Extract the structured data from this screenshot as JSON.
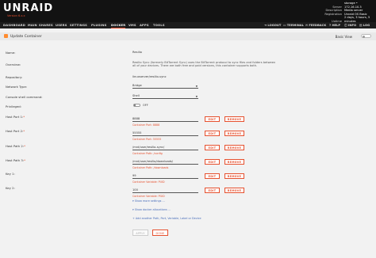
{
  "brand": {
    "logo": "UNRAID",
    "logo_sub": "Version 6.x.x"
  },
  "server_info": [
    {
      "key": "Server",
      "value": "storage • 172.16.10.3"
    },
    {
      "key": "Description",
      "value": "Media server"
    },
    {
      "key": "Registration",
      "value": "Unraid OS Basic"
    },
    {
      "key": "Uptime",
      "value": "2 days, 3 hours, 5 minutes"
    }
  ],
  "nav": {
    "items": [
      "DASHBOARD",
      "MAIN",
      "SHARES",
      "USERS",
      "SETTINGS",
      "PLUGINS",
      "DOCKER",
      "VMS",
      "APPS",
      "TOOLS"
    ],
    "active": "DOCKER",
    "right": [
      "LOGOUT",
      "TERMINAL",
      "FEEDBACK",
      "HELP",
      "INFO",
      "LOG"
    ]
  },
  "page": {
    "title": "Update Container",
    "basic_view_label": "Basic View"
  },
  "form": {
    "name": {
      "label": "Name:",
      "value": "Resilio"
    },
    "overview": {
      "label": "Overview:",
      "value": "Resilio Sync (formerly BitTorrent Sync) uses the BitTorrent protocol to sync files and folders between all of your devices. There are both free and paid versions, this container supports both."
    },
    "repository": {
      "label": "Repository:",
      "value": "linuxserver/resilio-sync"
    },
    "network_type": {
      "label": "Network Type:",
      "value": "Bridge"
    },
    "console_shell": {
      "label": "Console shell command:",
      "value": "Shell"
    },
    "privileged": {
      "label": "Privileged:",
      "value": "OFF"
    },
    "host_port_1": {
      "label": "Host Port 1:",
      "value": "8888",
      "hint": "Container Port: 8888"
    },
    "host_port_2": {
      "label": "Host Port 2:",
      "value": "55555",
      "hint": "Container Port: 55555"
    },
    "host_path_2": {
      "label": "Host Path 2:",
      "value": "/mnt/user/resilio-sync/",
      "hint": "Container Path: /config"
    },
    "host_path_3": {
      "label": "Host Path 3:",
      "value": "/mnt/user/resilio/downloads/",
      "hint": "Container Path: /downloads"
    },
    "key_1": {
      "label": "Key 1:",
      "value": "99",
      "hint": "Container Variable: PUID"
    },
    "key_2": {
      "label": "Key 2:",
      "value": "100",
      "hint": "Container Variable: PGID"
    }
  },
  "buttons": {
    "edit": "EDIT",
    "remove": "REMOVE",
    "apply": "APPLY",
    "done": "DONE"
  },
  "links": {
    "show_more": "Show more settings ...",
    "show_allocations": "Show docker allocations ...",
    "add_another": "Add another Path, Port, Variable, Label or Device"
  },
  "colors": {
    "accent": "#e6502e",
    "header_bg": "#121212"
  }
}
